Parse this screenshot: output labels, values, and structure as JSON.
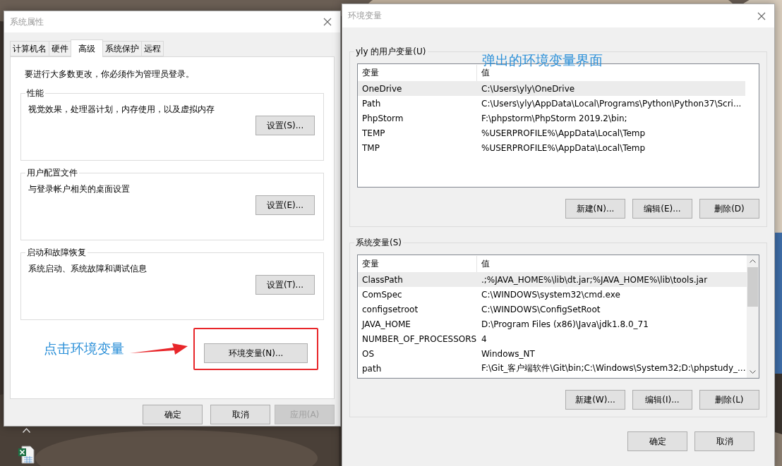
{
  "system_properties": {
    "title": "系统属性",
    "tabs": [
      {
        "label": "计算机名",
        "selected": false
      },
      {
        "label": "硬件",
        "selected": false
      },
      {
        "label": "高级",
        "selected": true
      },
      {
        "label": "系统保护",
        "selected": false
      },
      {
        "label": "远程",
        "selected": false
      }
    ],
    "notice": "要进行大多数更改，你必须作为管理员登录。",
    "groups": [
      {
        "title": "性能",
        "description": "视觉效果，处理器计划，内存使用，以及虚拟内存",
        "button": "设置(S)..."
      },
      {
        "title": "用户配置文件",
        "description": "与登录帐户相关的桌面设置",
        "button": "设置(E)..."
      },
      {
        "title": "启动和故障恢复",
        "description": "系统启动、系统故障和调试信息",
        "button": "设置(T)..."
      }
    ],
    "env_button": {
      "label": "环境变量(N)...",
      "highlighted": true
    },
    "buttons": [
      {
        "label": "确定",
        "disabled": false
      },
      {
        "label": "取消",
        "disabled": false
      },
      {
        "label": "应用(A)",
        "disabled": true
      }
    ]
  },
  "environment_variables": {
    "title": "环境变量",
    "user_vars": {
      "title": "yly 的用户变量(U)",
      "columns": [
        "变量",
        "值"
      ],
      "rows": [
        {
          "name": "OneDrive",
          "value": "C:\\Users\\yly\\OneDrive",
          "selected": true
        },
        {
          "name": "Path",
          "value": "C:\\Users\\yly\\AppData\\Local\\Programs\\Python\\Python37\\Scri...",
          "selected": false
        },
        {
          "name": "PhpStorm",
          "value": "F:\\phpstorm\\PhpStorm 2019.2\\bin;",
          "selected": false
        },
        {
          "name": "TEMP",
          "value": "%USERPROFILE%\\AppData\\Local\\Temp",
          "selected": false
        },
        {
          "name": "TMP",
          "value": "%USERPROFILE%\\AppData\\Local\\Temp",
          "selected": false
        }
      ],
      "buttons": [
        "新建(N)...",
        "编辑(E)...",
        "删除(D)"
      ]
    },
    "system_vars": {
      "title": "系统变量(S)",
      "columns": [
        "变量",
        "值"
      ],
      "rows": [
        {
          "name": "ClassPath",
          "value": ".;%JAVA_HOME%\\lib\\dt.jar;%JAVA_HOME%\\lib\\tools.jar",
          "selected": true
        },
        {
          "name": "ComSpec",
          "value": "C:\\WINDOWS\\system32\\cmd.exe",
          "selected": false
        },
        {
          "name": "configsetroot",
          "value": "C:\\WINDOWS\\ConfigSetRoot",
          "selected": false
        },
        {
          "name": "JAVA_HOME",
          "value": "D:\\Program Files (x86)\\Java\\jdk1.8.0_71",
          "selected": false
        },
        {
          "name": "NUMBER_OF_PROCESSORS",
          "value": "4",
          "selected": false
        },
        {
          "name": "OS",
          "value": "Windows_NT",
          "selected": false
        },
        {
          "name": "path",
          "value": "F:\\Git_客户端软件\\Git\\bin;C:\\Windows\\System32;D:\\phpstudy_...",
          "selected": false
        }
      ],
      "buttons": [
        "新建(W)...",
        "编辑(I)...",
        "删除(L)"
      ]
    },
    "buttons": [
      "确定",
      "取消"
    ]
  },
  "annotations": {
    "click_label": "点击环境变量",
    "popup_label": "弹出的环境变量界面"
  }
}
